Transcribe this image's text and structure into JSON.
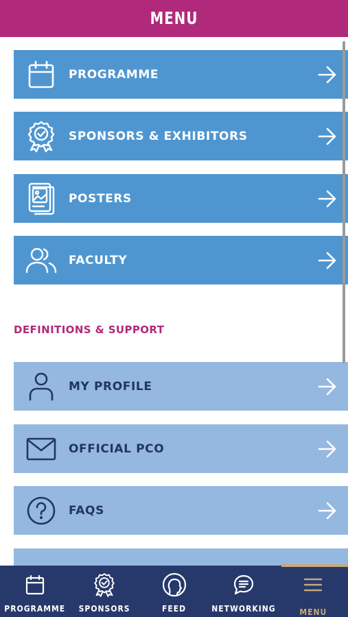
{
  "header": {
    "title": "MENU"
  },
  "colors": {
    "brand": "#b0297a",
    "primary_item": "#4f96d1",
    "secondary_item": "#95b8e0",
    "nav_bg": "#26396a",
    "nav_active": "#c8a97a"
  },
  "main_items": [
    {
      "label": "PROGRAMME",
      "icon": "calendar-icon"
    },
    {
      "label": "SPONSORS & EXHIBITORS",
      "icon": "award-badge-icon"
    },
    {
      "label": "POSTERS",
      "icon": "poster-icon"
    },
    {
      "label": "FACULTY",
      "icon": "people-icon"
    }
  ],
  "support_section": {
    "heading": "DEFINITIONS & SUPPORT",
    "items": [
      {
        "label": "MY PROFILE",
        "icon": "user-icon"
      },
      {
        "label": "OFFICIAL PCO",
        "icon": "envelope-icon"
      },
      {
        "label": "FAQS",
        "icon": "question-circle-icon"
      }
    ]
  },
  "bottom_nav": [
    {
      "label": "PROGRAMME",
      "icon": "calendar-icon",
      "active": false
    },
    {
      "label": "SPONSORS",
      "icon": "award-badge-icon",
      "active": false
    },
    {
      "label": "FEED",
      "icon": "feed-head-icon",
      "active": false
    },
    {
      "label": "NETWORKING",
      "icon": "chat-bubble-icon",
      "active": false
    },
    {
      "label": "MENU",
      "icon": "hamburger-icon",
      "active": true
    }
  ]
}
